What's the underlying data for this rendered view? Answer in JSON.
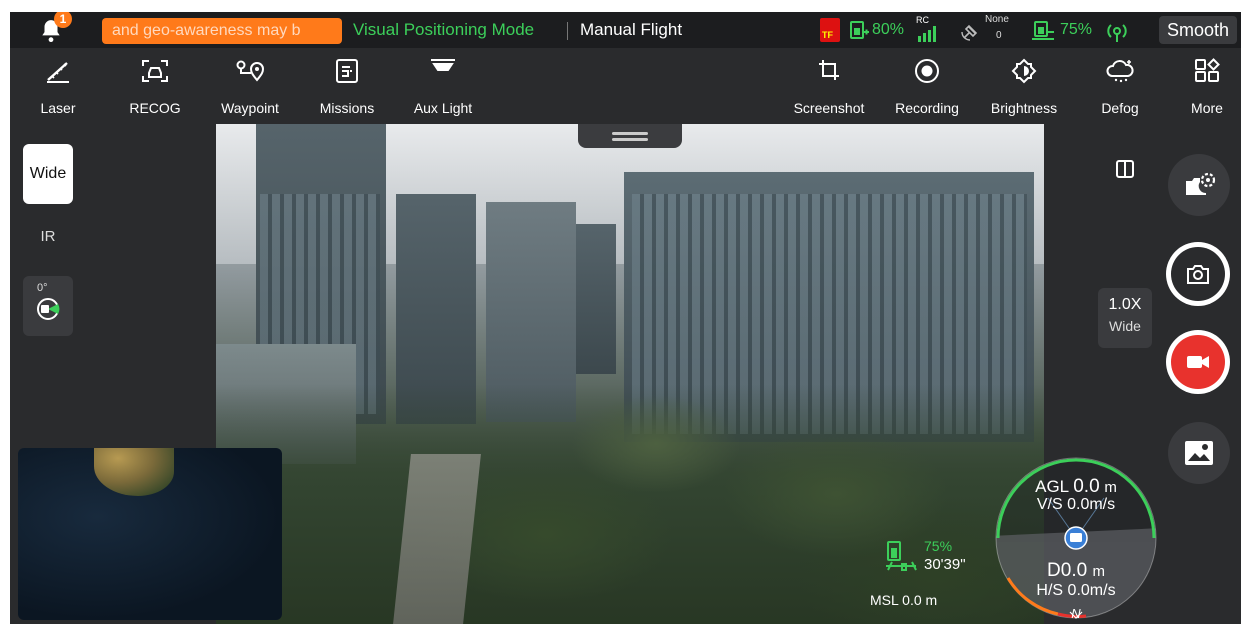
{
  "notification": {
    "count": "1"
  },
  "status_bar": {
    "marquee_text": "and geo-awareness may b",
    "positioning_mode": "Visual Positioning Mode",
    "flight_mode": "Manual Flight",
    "sd_label": "TF",
    "aircraft_battery": "80%",
    "rc_label": "RC",
    "gps_label": "None",
    "gps_count": "0",
    "rc_battery": "75%",
    "transmission": "Smooth"
  },
  "toolbar": {
    "laser": "Laser",
    "recog": "RECOG",
    "waypoint": "Waypoint",
    "missions": "Missions",
    "aux_light": "Aux Light",
    "screenshot": "Screenshot",
    "recording": "Recording",
    "brightness": "Brightness",
    "defog": "Defog",
    "more": "More"
  },
  "lens": {
    "wide": "Wide",
    "ir": "IR",
    "gimbal_angle": "0°"
  },
  "zoom": {
    "level": "1.0X",
    "lens": "Wide"
  },
  "telemetry": {
    "battery_pct": "75%",
    "flight_time": "30'39\"",
    "msl_label": "MSL",
    "msl_value": "0.0 m",
    "agl_label": "AGL",
    "agl_value": "0.0",
    "agl_unit": "m",
    "vs_label": "V/S",
    "vs_value": "0.0m/s",
    "d_label": "D",
    "d_value": "0.0",
    "d_unit": "m",
    "hs_label": "H/S",
    "hs_value": "0.0m/s",
    "heading": "N"
  },
  "colors": {
    "accent_green": "#3ccf5a",
    "warning_orange": "#ff7a1a",
    "record_red": "#e8322d"
  }
}
